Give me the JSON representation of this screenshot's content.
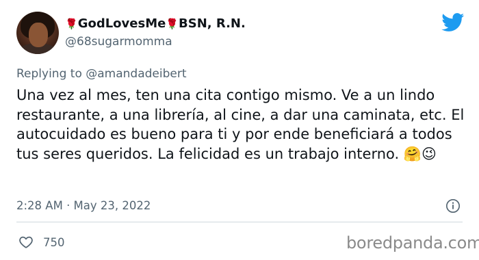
{
  "author": {
    "display_name_part1": "GodLovesMe",
    "display_name_part2": "BSN, R.N.",
    "handle": "@68sugarmomma",
    "name_emoji": "rose-emoji"
  },
  "reply": {
    "prefix": "Replying to",
    "mention": "@amandadeibert"
  },
  "tweet": {
    "text": "Una vez al mes, ten una cita contigo mismo. Ve a un lindo restaurante, a una librería, al cine, a dar una caminata, etc. El autocuidado es bueno para ti y por ende beneficiará a todos tus seres queridos. La felicidad es un trabajo interno.",
    "emojis": "🤗😉"
  },
  "meta": {
    "timestamp": "2:28 AM · May 23, 2022",
    "like_count": "750"
  },
  "watermark": "boredpanda.com",
  "icons": [
    "twitter-bird-icon",
    "info-icon",
    "heart-icon"
  ],
  "colors": {
    "twitter_blue": "#1d9bf0",
    "secondary_text": "#536471",
    "divider": "#cfd9de"
  }
}
